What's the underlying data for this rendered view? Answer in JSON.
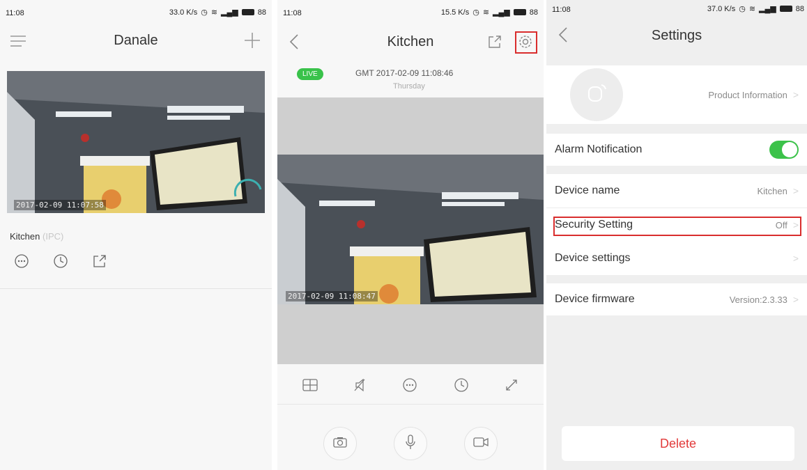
{
  "screen1": {
    "status": {
      "time": "11:08",
      "speed": "33.0 K/s",
      "battery": "88"
    },
    "title": "Danale",
    "snapshot_timestamp": "2017-02-09  11:07:58",
    "device_name": "Kitchen",
    "device_type": "(IPC)"
  },
  "screen2": {
    "status": {
      "time": "11:08",
      "speed": "15.5 K/s",
      "battery": "88"
    },
    "title": "Kitchen",
    "live_badge": "LIVE",
    "datetime": "GMT 2017-02-09 11:08:46",
    "weekday": "Thursday",
    "video_timestamp": "2017-02-09  11:08:47"
  },
  "screen3": {
    "status": {
      "time": "11:08",
      "speed": "37.0 K/s",
      "battery": "88"
    },
    "title": "Settings",
    "product_info": "Product Information",
    "alarm_label": "Alarm Notification",
    "device_name_label": "Device name",
    "device_name_value": "Kitchen",
    "security_label": "Security Setting",
    "security_value": "Off",
    "device_settings_label": "Device settings",
    "firmware_label": "Device firmware",
    "firmware_value": "Version:2.3.33",
    "delete_label": "Delete"
  },
  "colors": {
    "accent_green": "#3cc24a",
    "delete_red": "#e23a3a",
    "highlight_red": "#d92d2d"
  }
}
